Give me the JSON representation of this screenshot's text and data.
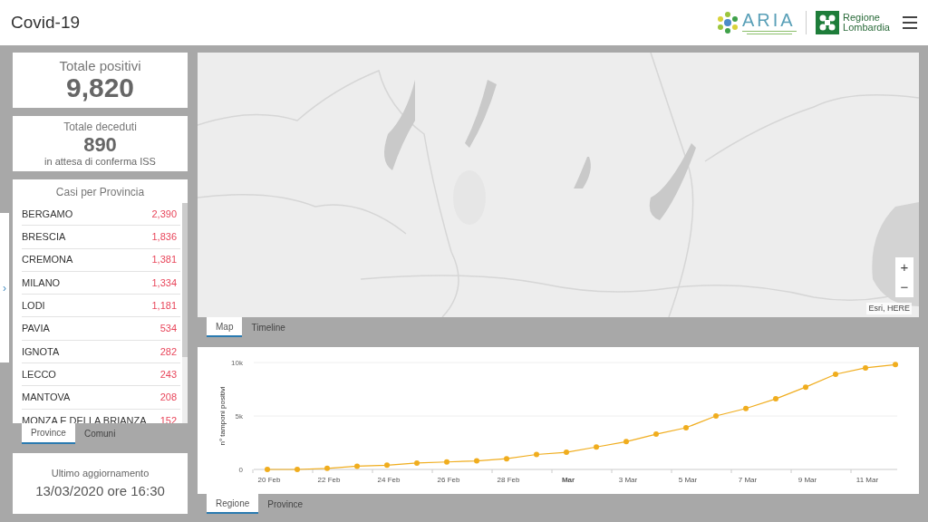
{
  "header": {
    "title": "Covid-19",
    "logos": [
      {
        "kind": "aria",
        "text": "ARIA"
      },
      {
        "kind": "lombardia",
        "line1": "Regione",
        "line2": "Lombardia"
      }
    ]
  },
  "totals": [
    {
      "label": "Totale positivi",
      "value": "9,820"
    },
    {
      "label": "Totale deceduti",
      "value": "890",
      "note": "in attesa di conferma ISS"
    }
  ],
  "province_list": {
    "title": "Casi per Provincia",
    "rows": [
      {
        "name": "BERGAMO",
        "count": "2,390"
      },
      {
        "name": "BRESCIA",
        "count": "1,836"
      },
      {
        "name": "CREMONA",
        "count": "1,381"
      },
      {
        "name": "MILANO",
        "count": "1,334"
      },
      {
        "name": "LODI",
        "count": "1,181"
      },
      {
        "name": "PAVIA",
        "count": "534"
      },
      {
        "name": "IGNOTA",
        "count": "282"
      },
      {
        "name": "LECCO",
        "count": "243"
      },
      {
        "name": "MANTOVA",
        "count": "208"
      },
      {
        "name": "MONZA E DELLA BRIANZA",
        "count": "152"
      }
    ],
    "tabs": [
      {
        "label": "Province",
        "selected": true
      },
      {
        "label": "Comuni",
        "selected": false
      }
    ]
  },
  "side_panel": {
    "toggle": "›"
  },
  "update": {
    "label": "Ultimo aggiornamento",
    "value": "13/03/2020 ore 16:30"
  },
  "map": {
    "kind": "picture",
    "zoom_in": "+",
    "zoom_out": "−",
    "attribution": "Esri, HERE",
    "tabs": [
      {
        "label": "Map",
        "selected": true
      },
      {
        "label": "Timeline",
        "selected": false
      }
    ]
  },
  "chart": {
    "tabs": [
      {
        "label": "Regione",
        "selected": true
      },
      {
        "label": "Province",
        "selected": false
      }
    ],
    "chart_data": {
      "type": "line",
      "ylabel": "n° tamponi positivi",
      "categories": [
        "20 Feb",
        null,
        "22 Feb",
        null,
        "24 Feb",
        null,
        "26 Feb",
        null,
        "28 Feb",
        null,
        "Mar",
        null,
        "3 Mar",
        null,
        "5 Mar",
        null,
        "7 Mar",
        null,
        "9 Mar",
        null,
        "11 Mar",
        null
      ],
      "series": [
        {
          "color": "#f0ad1e",
          "marker": "circle",
          "values": [
            0,
            0,
            100,
            300,
            400,
            600,
            700,
            800,
            1000,
            1400,
            1600,
            2100,
            2600,
            3300,
            3900,
            5000,
            5700,
            6600,
            7700,
            8900,
            9500,
            9800
          ]
        }
      ],
      "ylim": [
        0,
        10000
      ],
      "yticks": [
        {
          "value": 0,
          "label": "0"
        },
        {
          "value": 5000,
          "label": "5k"
        },
        {
          "value": 10000,
          "label": "10k"
        }
      ]
    }
  }
}
